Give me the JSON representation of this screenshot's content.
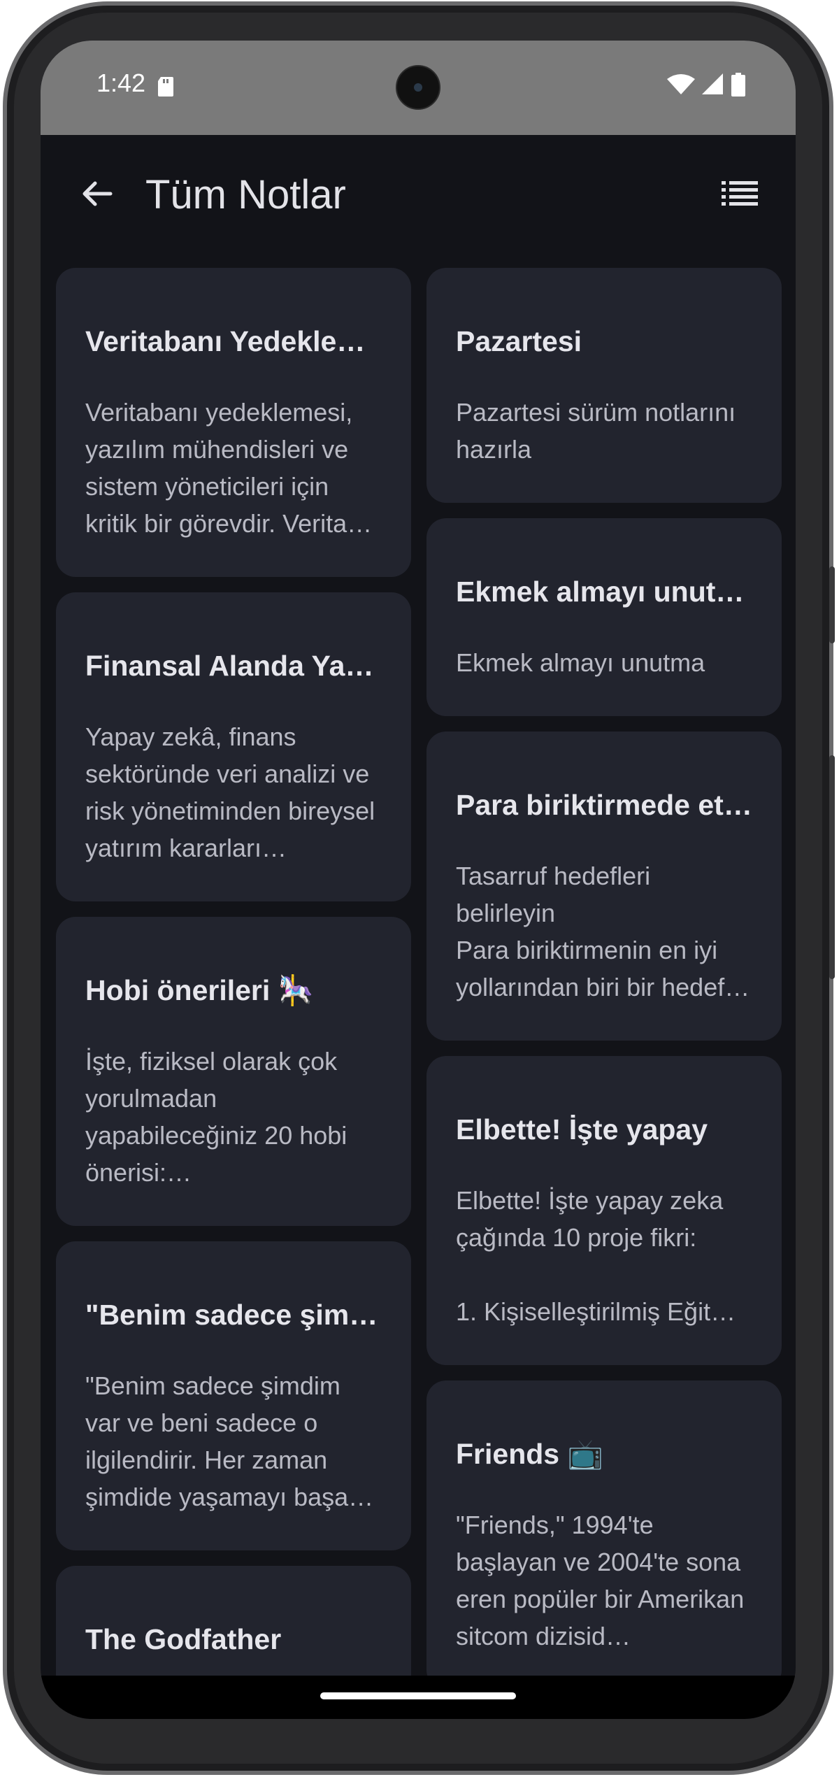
{
  "status_bar": {
    "time": "1:42"
  },
  "app_bar": {
    "title": "Tüm Notlar",
    "back_icon": "arrow-back-icon",
    "view_toggle_icon": "list-view-icon"
  },
  "notes_left": [
    {
      "title": "Veritabanı Yedekle…",
      "body": "Veritabanı yedeklemesi, yazılım mühendisleri ve sistem yöneticileri için kritik bir görevdir. Verita…"
    },
    {
      "title": "Finansal Alanda Yap…",
      "body": "Yapay zekâ, finans sektöründe veri analizi ve risk yönetiminden bireysel yatırım kararları…"
    },
    {
      "title": "Hobi önerileri 🎠",
      "body": "İşte, fiziksel olarak çok yorulmadan yapabileceğiniz 20 hobi önerisi:…"
    },
    {
      "title": "\"Benim sadece şimd…",
      "body": "\"Benim sadece şimdim var ve beni sadece o ilgilendirir. Her zaman şimdide yaşamayı başa…"
    },
    {
      "title": "The Godfather",
      "body": ""
    }
  ],
  "notes_right": [
    {
      "title": "Pazartesi",
      "body": "Pazartesi sürüm notlarını hazırla"
    },
    {
      "title": "Ekmek almayı unut…",
      "body": "Ekmek almayı unutma"
    },
    {
      "title": "Para biriktirmede et…",
      "body": "Tasarruf hedefleri belirleyin\nPara biriktirmenin en iyi yollarından biri bir hedef…"
    },
    {
      "title": "Elbette! İşte yapay",
      "body": "Elbette! İşte yapay zeka çağında 10 proje fikri:\n\n  1. Kişiselleştirilmiş Eğit…"
    },
    {
      "title": "Friends 📺",
      "body": "\"Friends,\" 1994'te başlayan ve 2004'te sona eren popüler bir Amerikan sitcom dizisid…"
    }
  ]
}
